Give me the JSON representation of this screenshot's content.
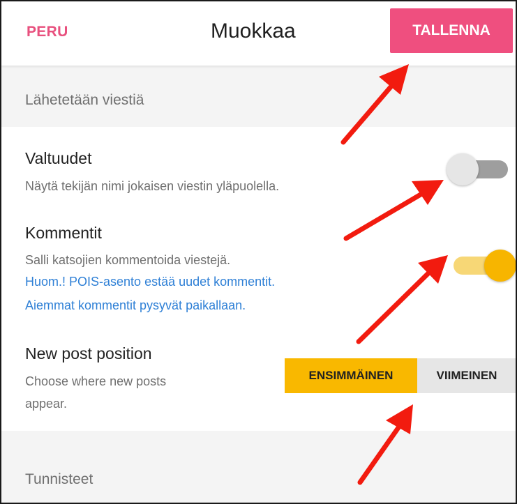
{
  "header": {
    "cancel_label": "PERU",
    "title": "Muokkaa",
    "save_label": "TALLENNA"
  },
  "sections": {
    "sending": "Lähetetään viestiä",
    "tags": "Tunnisteet"
  },
  "settings": {
    "credentials": {
      "title": "Valtuudet",
      "description": "Näytä tekijän nimi jokaisen viestin yläpuolella.",
      "enabled": false
    },
    "comments": {
      "title": "Kommentit",
      "description": "Salli katsojien kommentoida viestejä.",
      "note_line1": "Huom.! POIS-asento estää uudet kommentit.",
      "note_line2": "Aiemmat kommentit pysyvät paikallaan.",
      "enabled": true
    },
    "post_position": {
      "title": "New post position",
      "description_line1": "Choose where new posts",
      "description_line2": "appear.",
      "options": [
        "ENSIMMÄINEN",
        "VIIMEINEN"
      ],
      "selected": "ENSIMMÄINEN"
    }
  },
  "colors": {
    "accent_pink": "#ef4f7f",
    "toggle_on": "#f7b500",
    "segment_selected": "#f9b800",
    "annotation_arrow": "#f21b0f",
    "link_blue": "#2f80d6"
  },
  "icons": {
    "annotation": "red-arrow-icon"
  }
}
